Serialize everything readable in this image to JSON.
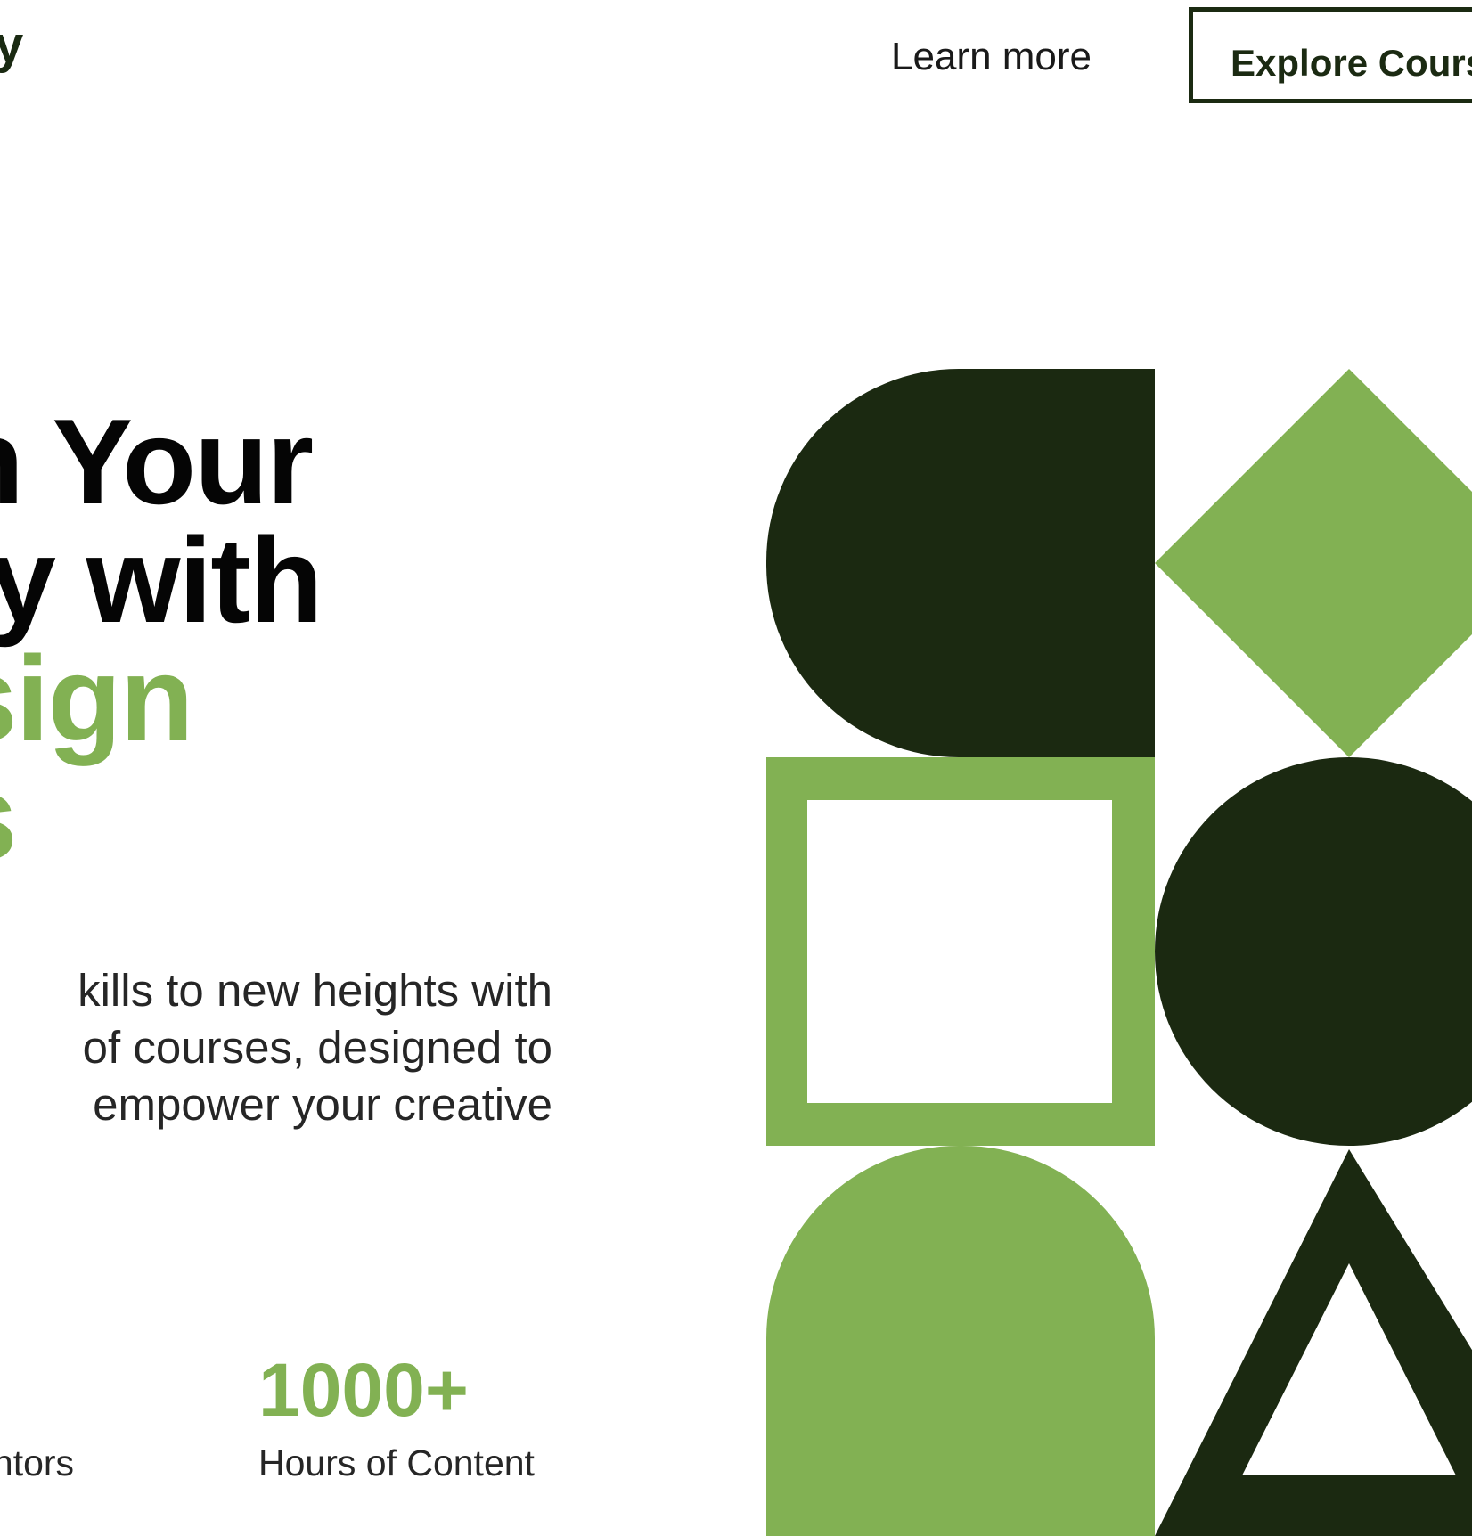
{
  "header": {
    "logo_fragment": "y",
    "nav": {
      "learn_more": "Learn more",
      "explore_courses": "Explore Courses"
    }
  },
  "hero": {
    "heading_lines": [
      "n Your",
      "ty with",
      "sign",
      "s"
    ],
    "description_lines": [
      "kills to new heights with",
      "of courses, designed to",
      "empower your creative"
    ]
  },
  "stats": [
    {
      "value": "",
      "label": "lentors"
    },
    {
      "value": "1000+",
      "label": "Hours of Content"
    }
  ],
  "illustration": {
    "colors": {
      "dark_green": "#1b2911",
      "light_green": "#82b153",
      "white": "#ffffff"
    },
    "shapes": [
      "rounded-half-shape",
      "diamond-shape",
      "square-outline-shape",
      "circle-shape",
      "rounded-top-shape",
      "triangle-outline-shape"
    ]
  }
}
